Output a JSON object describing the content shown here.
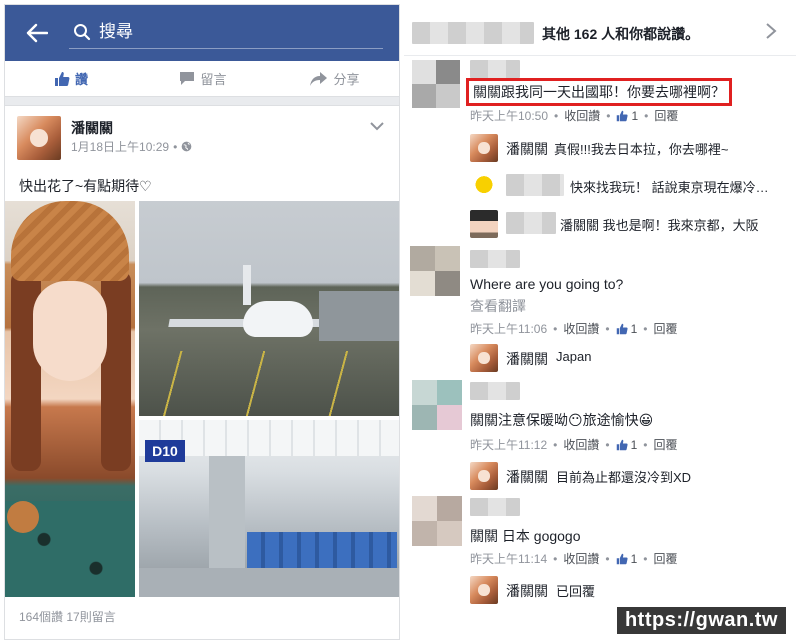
{
  "left": {
    "search": {
      "placeholder": "搜尋"
    },
    "actions": [
      {
        "label": "讚",
        "icon": "thumbs-up-icon",
        "active": true
      },
      {
        "label": "留言",
        "icon": "comment-icon",
        "active": false
      },
      {
        "label": "分享",
        "icon": "share-icon",
        "active": false
      }
    ],
    "post": {
      "author": "潘關關",
      "timestamp": "1月18日上午10:29",
      "privacy_icon": "globe-icon",
      "text": "快出花了~有點期待♡",
      "photos": [
        {
          "subject": "selfie-with-hat"
        },
        {
          "subject": "airplane-at-gate"
        },
        {
          "subject": "airport-gate-lounge",
          "sign": "D10"
        }
      ],
      "stats": "164個讚  17則留言"
    }
  },
  "right": {
    "likes_text": "其他 162 人和你都說讚。",
    "comments": [
      {
        "text": "關關跟我同一天出國耶！你要去哪裡啊？",
        "highlighted": true,
        "time": "昨天上午10:50",
        "withdraw": "收回讚",
        "likes": "1",
        "reply": "回覆",
        "replies": [
          {
            "name": "潘關關",
            "text": "真假!!!我去日本拉，你去哪裡~",
            "avatar": "author"
          },
          {
            "name": "",
            "text": "快來找我玩！ 話說東京現在爆冷…",
            "avatar": "yellow"
          },
          {
            "name": "",
            "text": "潘關關 我也是啊！我來京都，大阪",
            "avatar": "person"
          }
        ]
      },
      {
        "text": "Where are you going to?",
        "translate": "查看翻譯",
        "time": "昨天上午11:06",
        "withdraw": "收回讚",
        "likes": "1",
        "reply": "回覆",
        "replies": [
          {
            "name": "潘關關",
            "text": "Japan",
            "avatar": "author"
          }
        ]
      },
      {
        "text": "關關注意保暖呦😶旅途愉快😀",
        "time": "昨天上午11:12",
        "withdraw": "收回讚",
        "likes": "1",
        "reply": "回覆",
        "replies": [
          {
            "name": "潘關關",
            "text": "目前為止都還沒冷到XD",
            "avatar": "author"
          }
        ]
      },
      {
        "text": "關關 日本 gogogo",
        "time": "昨天上午11:14",
        "withdraw": "收回讚",
        "likes": "1",
        "reply": "回覆",
        "replies": [
          {
            "name": "潘關關",
            "text": "已回覆",
            "avatar": "author"
          }
        ]
      }
    ]
  },
  "watermark": "https://gwan.tw"
}
